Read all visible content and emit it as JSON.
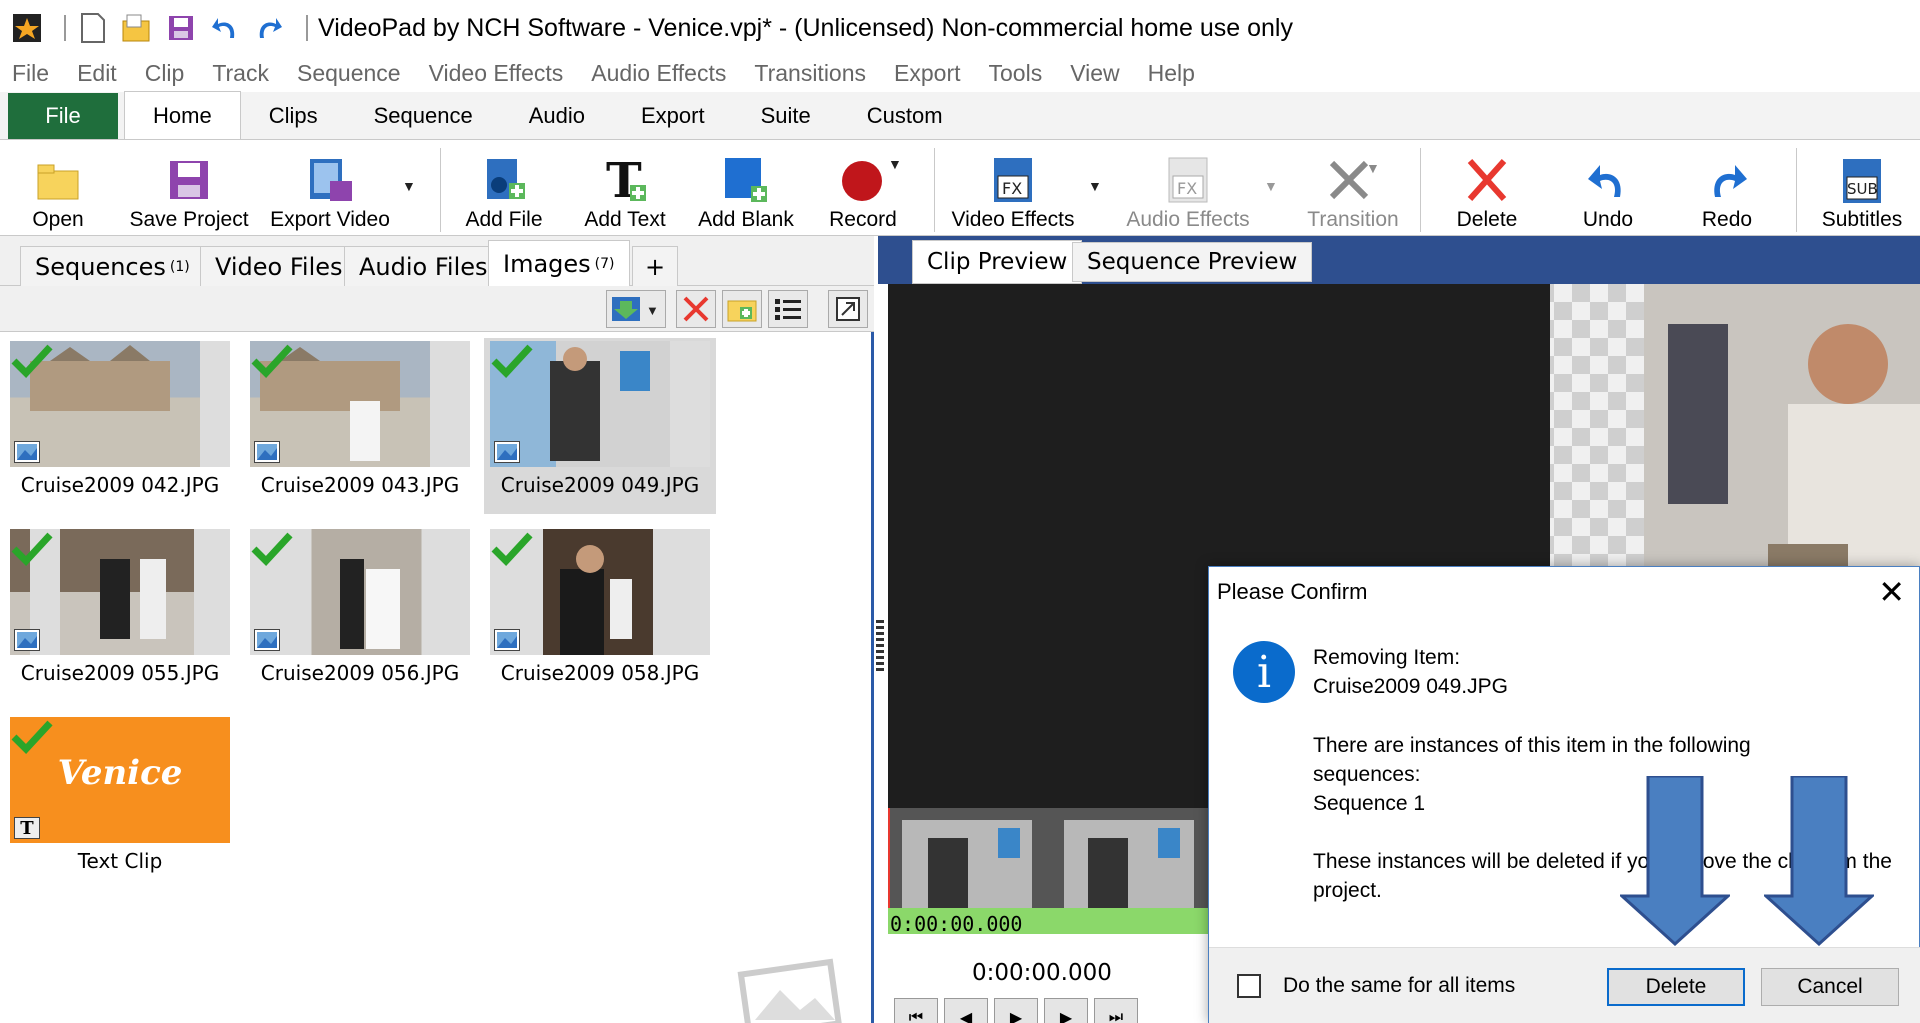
{
  "window": {
    "title": "VideoPad by NCH Software - Venice.vpj* - (Unlicensed) Non-commercial home use only"
  },
  "quick_access": [
    "app-logo-icon",
    "new-icon",
    "open-icon",
    "save-icon",
    "undo-icon",
    "redo-icon"
  ],
  "menu": [
    "File",
    "Edit",
    "Clip",
    "Track",
    "Sequence",
    "Video Effects",
    "Audio Effects",
    "Transitions",
    "Export",
    "Tools",
    "View",
    "Help"
  ],
  "ribbon_tabs": {
    "file": "File",
    "home": "Home",
    "clips": "Clips",
    "sequence": "Sequence",
    "audio": "Audio",
    "export": "Export",
    "suite": "Suite",
    "custom": "Custom"
  },
  "toolbar": {
    "open": "Open",
    "save_project": "Save Project",
    "export_video": "Export Video",
    "add_file": "Add File",
    "add_text": "Add Text",
    "add_blank": "Add Blank",
    "record": "Record",
    "video_effects": "Video Effects",
    "audio_effects": "Audio Effects",
    "transition": "Transition",
    "delete": "Delete",
    "undo": "Undo",
    "redo": "Redo",
    "subtitles": "Subtitles"
  },
  "bin_tabs": {
    "sequences": "Sequences",
    "sequences_count": "(1)",
    "video_files": "Video Files",
    "audio_files": "Audio Files",
    "images": "Images",
    "images_count": "(7)",
    "add": "+"
  },
  "media": [
    {
      "name": "Cruise2009 042.JPG",
      "type": "image",
      "selected": false
    },
    {
      "name": "Cruise2009 043.JPG",
      "type": "image",
      "selected": false
    },
    {
      "name": "Cruise2009 049.JPG",
      "type": "image",
      "selected": true
    },
    {
      "name": "Cruise2009 055.JPG",
      "type": "image",
      "selected": false
    },
    {
      "name": "Cruise2009 056.JPG",
      "type": "image",
      "selected": false
    },
    {
      "name": "Cruise2009 058.JPG",
      "type": "image",
      "selected": false
    },
    {
      "name": "Text Clip",
      "type": "text",
      "selected": false,
      "thumb_text": "Venice"
    }
  ],
  "preview": {
    "tab_clip": "Clip Preview",
    "tab_sequence": "Sequence Preview",
    "strip_time": "0:00:00.000",
    "current_time": "0:00:00.000"
  },
  "dialog": {
    "title": "Please Confirm",
    "close": "✕",
    "line1": "Removing Item:",
    "line2": "Cruise2009 049.JPG",
    "line3": "There are instances of this item in the following sequences:",
    "line4": "Sequence 1",
    "line5": "These instances will be deleted if you remove the clip from the project.",
    "checkbox_label": "Do the same for all items",
    "delete_button": "Delete",
    "cancel_button": "Cancel"
  },
  "colors": {
    "accent": "#2e4f8f",
    "file_tab": "#1f6e3c",
    "info_blue": "#0a6bcc",
    "arrow": "#4a7fc1",
    "timeline_green": "#8bd86a"
  }
}
